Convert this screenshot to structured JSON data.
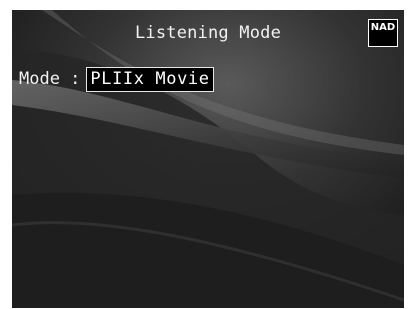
{
  "header": {
    "title": "Listening Mode",
    "logo_text": "NAD"
  },
  "mode": {
    "label": "Mode :",
    "value": "PLIIx Movie"
  },
  "colors": {
    "background": "#1b1b1b",
    "text": "#f2f2f2",
    "highlight_box": "#000000"
  }
}
